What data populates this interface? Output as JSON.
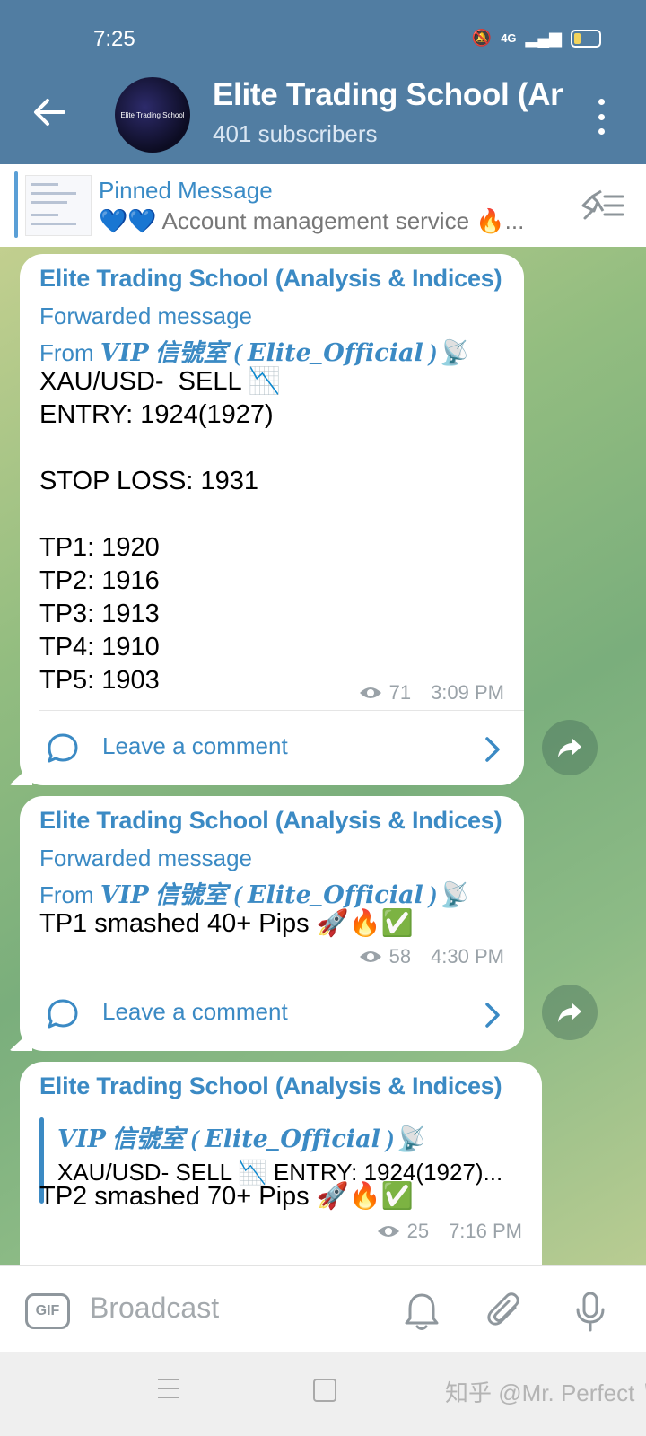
{
  "status_bar": {
    "time": "7:25",
    "network": "4G"
  },
  "header": {
    "title": "Elite Trading School (Analysis & Indices)",
    "subtitle": "401 subscribers",
    "avatar_text": "Elite Trading School"
  },
  "pinned": {
    "label": "Pinned Message",
    "text": "💙💙 Account management service 🔥..."
  },
  "messages": [
    {
      "channel": "Elite Trading School (Analysis & Indices)",
      "forward_label": "Forwarded message",
      "forward_from_prefix": "From ",
      "forward_from_name": "𝑽𝑰𝑷 信號室 ( 𝑬𝒍𝒊𝒕𝒆_𝑶𝒇𝒇𝒊𝒄𝒊𝒂𝒍 )📡",
      "body": "XAU/USD-  SELL 📉\nENTRY: 1924(1927)\n\nSTOP LOSS: 1931\n\nTP1: 1920\nTP2: 1916\nTP3: 1913\nTP4: 1910\nTP5: 1903",
      "views": "71",
      "time": "3:09 PM",
      "comment_label": "Leave a comment"
    },
    {
      "channel": "Elite Trading School (Analysis & Indices)",
      "forward_label": "Forwarded message",
      "forward_from_prefix": "From ",
      "forward_from_name": "𝑽𝑰𝑷 信號室 ( 𝑬𝒍𝒊𝒕𝒆_𝑶𝒇𝒇𝒊𝒄𝒊𝒂𝒍 )📡",
      "body": "TP1 smashed 40+ Pips 🚀🔥✅",
      "views": "58",
      "time": "4:30 PM",
      "comment_label": "Leave a comment"
    },
    {
      "channel": "Elite Trading School (Analysis & Indices)",
      "reply_from": "𝑽𝑰𝑷 信號室 ( 𝑬𝒍𝒊𝒕𝒆_𝑶𝒇𝒇𝒊𝒄𝒊𝒂𝒍 )📡",
      "reply_text": "XAU/USD-  SELL 📉   ENTRY: 1924(1927)...",
      "body": "TP2 smashed 70+ Pips 🚀🔥✅",
      "views": "25",
      "time": "7:16 PM"
    }
  ],
  "input": {
    "placeholder": "Broadcast",
    "gif_label": "GIF"
  },
  "watermark": "知乎 @Mr. Perfect 🏳",
  "icons": {
    "back": "arrow-left-icon",
    "menu": "more-vert-icon",
    "unpin": "unpin-list-icon",
    "views": "eye-icon",
    "comment": "comment-icon",
    "share": "share-icon",
    "bell": "bell-icon",
    "attach": "paperclip-icon",
    "mic": "mic-icon"
  },
  "colors": {
    "header": "#517da2",
    "accent": "#3b8ac4"
  }
}
